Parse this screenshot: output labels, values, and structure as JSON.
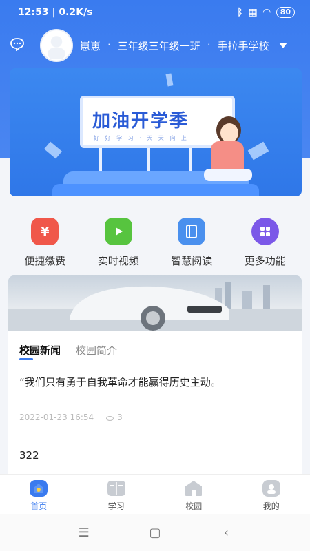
{
  "status_bar": {
    "time_speed": "12:53 | 0.2K/s",
    "battery": "80"
  },
  "header": {
    "user_name": "崽崽",
    "class_name": "三年级三年级一班",
    "school_name": "手拉手学校",
    "separator": "·"
  },
  "banner": {
    "title": "加油开学季",
    "subtitle": "好 好 学 习 · 天 天 向 上"
  },
  "quick_functions": [
    {
      "label": "便捷缴费",
      "icon": "payment-icon",
      "color": "#f0574a"
    },
    {
      "label": "实时视频",
      "icon": "video-icon",
      "color": "#57c43f"
    },
    {
      "label": "智慧阅读",
      "icon": "book-icon",
      "color": "#4a90ee"
    },
    {
      "label": "更多功能",
      "icon": "grid-icon",
      "color": "#7b58e8"
    }
  ],
  "news": {
    "tabs": [
      {
        "label": "校园新闻",
        "active": true
      },
      {
        "label": "校园简介",
        "active": false
      }
    ],
    "items": [
      {
        "title": "“我们只有勇于自我革命才能赢得历史主动。",
        "date": "2022-01-23 16:54",
        "views": "3"
      },
      {
        "title": "322"
      }
    ]
  },
  "tabbar": [
    {
      "label": "首页",
      "icon": "home-icon",
      "active": true
    },
    {
      "label": "学习",
      "icon": "study-icon",
      "active": false
    },
    {
      "label": "校园",
      "icon": "campus-icon",
      "active": false
    },
    {
      "label": "我的",
      "icon": "profile-icon",
      "active": false
    }
  ],
  "system_nav": {
    "menu": "☰",
    "home": "▢",
    "back": "‹"
  },
  "colors": {
    "primary": "#3a7bef",
    "background": "#f3f5f9"
  }
}
